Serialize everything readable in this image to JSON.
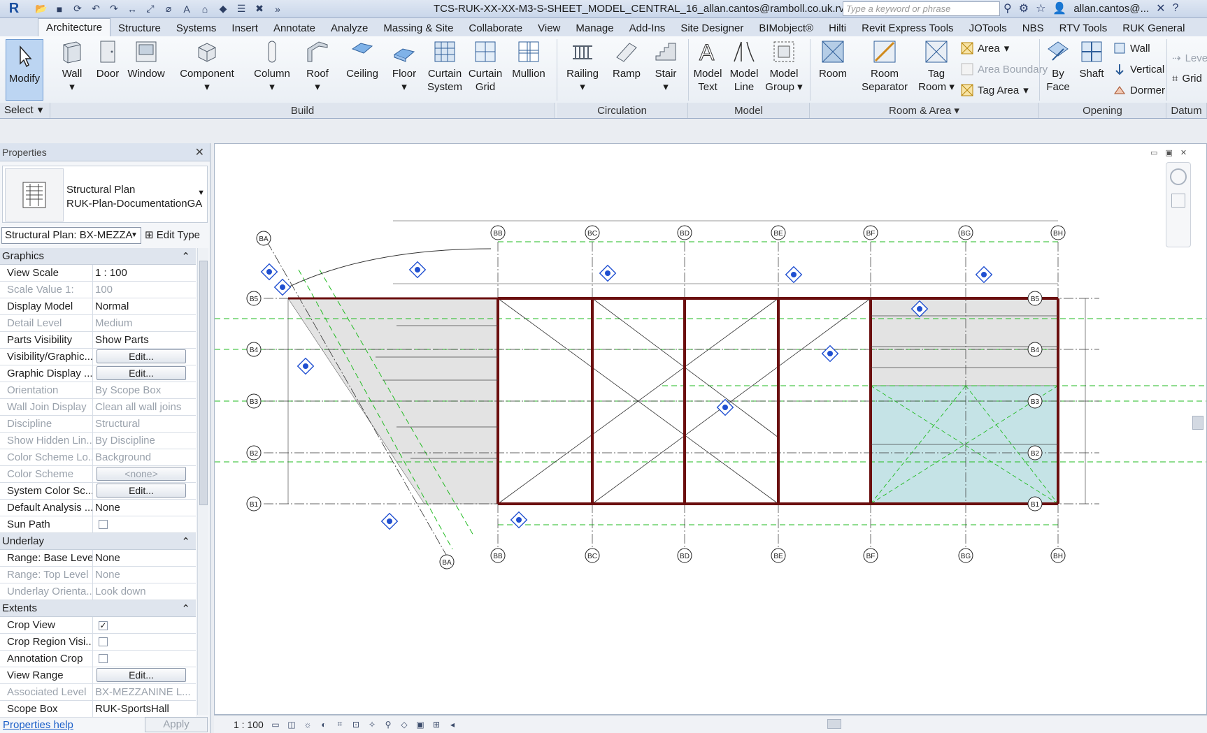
{
  "app": {
    "document_title": "TCS-RUK-XX-XX-M3-S-SHEET_MODEL_CENTRAL_16_allan.cantos@ramboll.co.uk.rvt ...",
    "search_placeholder": "Type a keyword or phrase",
    "user": "allan.cantos@...",
    "app_letter": "R"
  },
  "ribbon": {
    "tabs": [
      "Architecture",
      "Structure",
      "Systems",
      "Insert",
      "Annotate",
      "Analyze",
      "Massing & Site",
      "Collaborate",
      "View",
      "Manage",
      "Add-Ins",
      "Site Designer",
      "BIMobject®",
      "Hilti",
      "Revit Express Tools",
      "JOTools",
      "NBS",
      "RTV Tools",
      "RUK General"
    ],
    "active_tab": "Architecture",
    "modify": "Modify",
    "select": "Select",
    "build": {
      "label": "Build",
      "wall": "Wall",
      "door": "Door",
      "window": "Window",
      "component": "Component",
      "column": "Column",
      "roof": "Roof",
      "ceiling": "Ceiling",
      "floor": "Floor",
      "curtain_system_1": "Curtain",
      "curtain_system_2": "System",
      "curtain_grid_1": "Curtain",
      "curtain_grid_2": "Grid",
      "mullion": "Mullion"
    },
    "circulation": {
      "label": "Circulation",
      "railing": "Railing",
      "ramp": "Ramp",
      "stair": "Stair"
    },
    "model": {
      "label": "Model",
      "text_1": "Model",
      "text_2": "Text",
      "line_1": "Model",
      "line_2": "Line",
      "group_1": "Model",
      "group_2": "Group"
    },
    "room_area": {
      "label": "Room & Area",
      "room": "Room",
      "sep_1": "Room",
      "sep_2": "Separator",
      "tag_room_1": "Tag",
      "tag_room_2": "Room",
      "area": "Area",
      "area_boundary": "Area  Boundary",
      "tag_area": "Tag  Area"
    },
    "opening": {
      "label": "Opening",
      "by_face_1": "By",
      "by_face_2": "Face",
      "shaft": "Shaft",
      "wall": "Wall",
      "vertical": "Vertical",
      "dormer": "Dormer"
    },
    "datum": {
      "label": "Datum",
      "level": "Leve",
      "grid": "Grid"
    }
  },
  "properties": {
    "title": "Properties",
    "type_name_1": "Structural Plan",
    "type_name_2": "RUK-Plan-DocumentationGA",
    "instance": "Structural Plan: BX-MEZZA",
    "edit_type": "Edit Type",
    "groups": {
      "graphics": "Graphics",
      "underlay": "Underlay",
      "extents": "Extents"
    },
    "rows": {
      "view_scale": [
        "View Scale",
        "1 : 100"
      ],
      "scale_value": [
        "Scale Value    1:",
        "100"
      ],
      "display_model": [
        "Display Model",
        "Normal"
      ],
      "detail_level": [
        "Detail Level",
        "Medium"
      ],
      "parts_visibility": [
        "Parts Visibility",
        "Show Parts"
      ],
      "vis_graphics": [
        "Visibility/Graphic...",
        "Edit..."
      ],
      "graphic_display": [
        "Graphic Display ...",
        "Edit..."
      ],
      "orientation": [
        "Orientation",
        "By Scope Box"
      ],
      "wall_join": [
        "Wall Join Display",
        "Clean all wall joins"
      ],
      "discipline": [
        "Discipline",
        "Structural"
      ],
      "hidden_lines": [
        "Show Hidden Lin...",
        "By Discipline"
      ],
      "color_scheme_loc": [
        "Color Scheme Lo...",
        "Background"
      ],
      "color_scheme": [
        "Color Scheme",
        "<none>"
      ],
      "system_color": [
        "System Color Sc...",
        "Edit..."
      ],
      "default_analysis": [
        "Default Analysis ...",
        "None"
      ],
      "sun_path": [
        "Sun Path",
        ""
      ],
      "base_level": [
        "Range: Base Level",
        "None"
      ],
      "top_level": [
        "Range: Top Level",
        "None"
      ],
      "underlay_orient": [
        "Underlay Orienta...",
        "Look down"
      ],
      "crop_view": [
        "Crop View",
        "✓"
      ],
      "crop_region": [
        "Crop Region Visi...",
        ""
      ],
      "annotation_crop": [
        "Annotation Crop",
        ""
      ],
      "view_range": [
        "View Range",
        "Edit..."
      ],
      "assoc_level": [
        "Associated Level",
        "BX-MEZZANINE L..."
      ],
      "scope_box": [
        "Scope Box",
        "RUK-SportsHall"
      ]
    },
    "help": "Properties help",
    "apply": "Apply"
  },
  "view": {
    "scale": "1 : 100",
    "grids_top": [
      "BB",
      "BC",
      "BD",
      "BE",
      "BF",
      "BG",
      "BH"
    ],
    "grids_left": [
      "B5",
      "B4",
      "B3",
      "B2",
      "B1"
    ],
    "grid_diag": "BA"
  }
}
